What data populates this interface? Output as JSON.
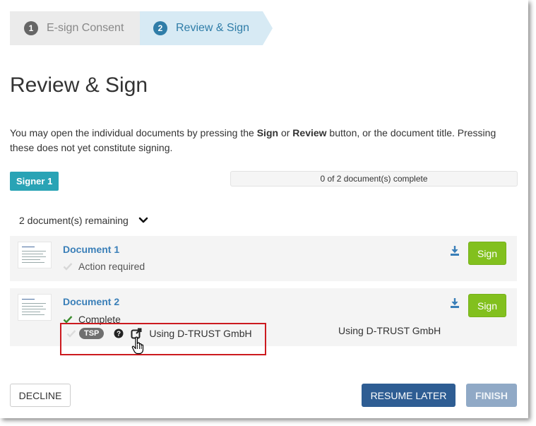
{
  "stepper": {
    "steps": [
      {
        "number": "1",
        "label": "E-sign Consent"
      },
      {
        "number": "2",
        "label": "Review & Sign"
      }
    ]
  },
  "page": {
    "title": "Review & Sign",
    "intro": {
      "part1": "You may open the individual documents by pressing the ",
      "sign_word": "Sign",
      "part2": " or ",
      "review_word": "Review",
      "part3": " button, or the document title. Pressing these does not yet constitute signing."
    }
  },
  "signer": {
    "badge": "Signer 1",
    "progress_text": "0 of 2 document(s) complete",
    "progress_fraction": 0
  },
  "documents_section": {
    "remaining_label": "2 document(s) remaining",
    "documents": [
      {
        "title": "Document 1",
        "status": "Action required",
        "sign_label": "Sign"
      },
      {
        "title": "Document 2",
        "status": "Complete",
        "sign_label": "Sign",
        "tsp_badge": "TSP",
        "tsp_provider_text": "Using D-TRUST GmbH",
        "tsp_right_text": "Using D-TRUST GmbH"
      }
    ]
  },
  "footer": {
    "decline_label": "DECLINE",
    "resume_label": "RESUME LATER",
    "finish_label": "FINISH"
  },
  "colors": {
    "sign_button": "#82c01e",
    "signer_badge": "#29a3b5",
    "resume_button": "#2e5d93",
    "finish_button_disabled": "#90a9c6",
    "link": "#3a7fb8",
    "highlight": "#cc1a1f"
  },
  "icons": [
    "download-icon",
    "check-icon",
    "help-icon",
    "external-link-icon",
    "chevron-down-icon",
    "hand-pointer-cursor-icon"
  ]
}
